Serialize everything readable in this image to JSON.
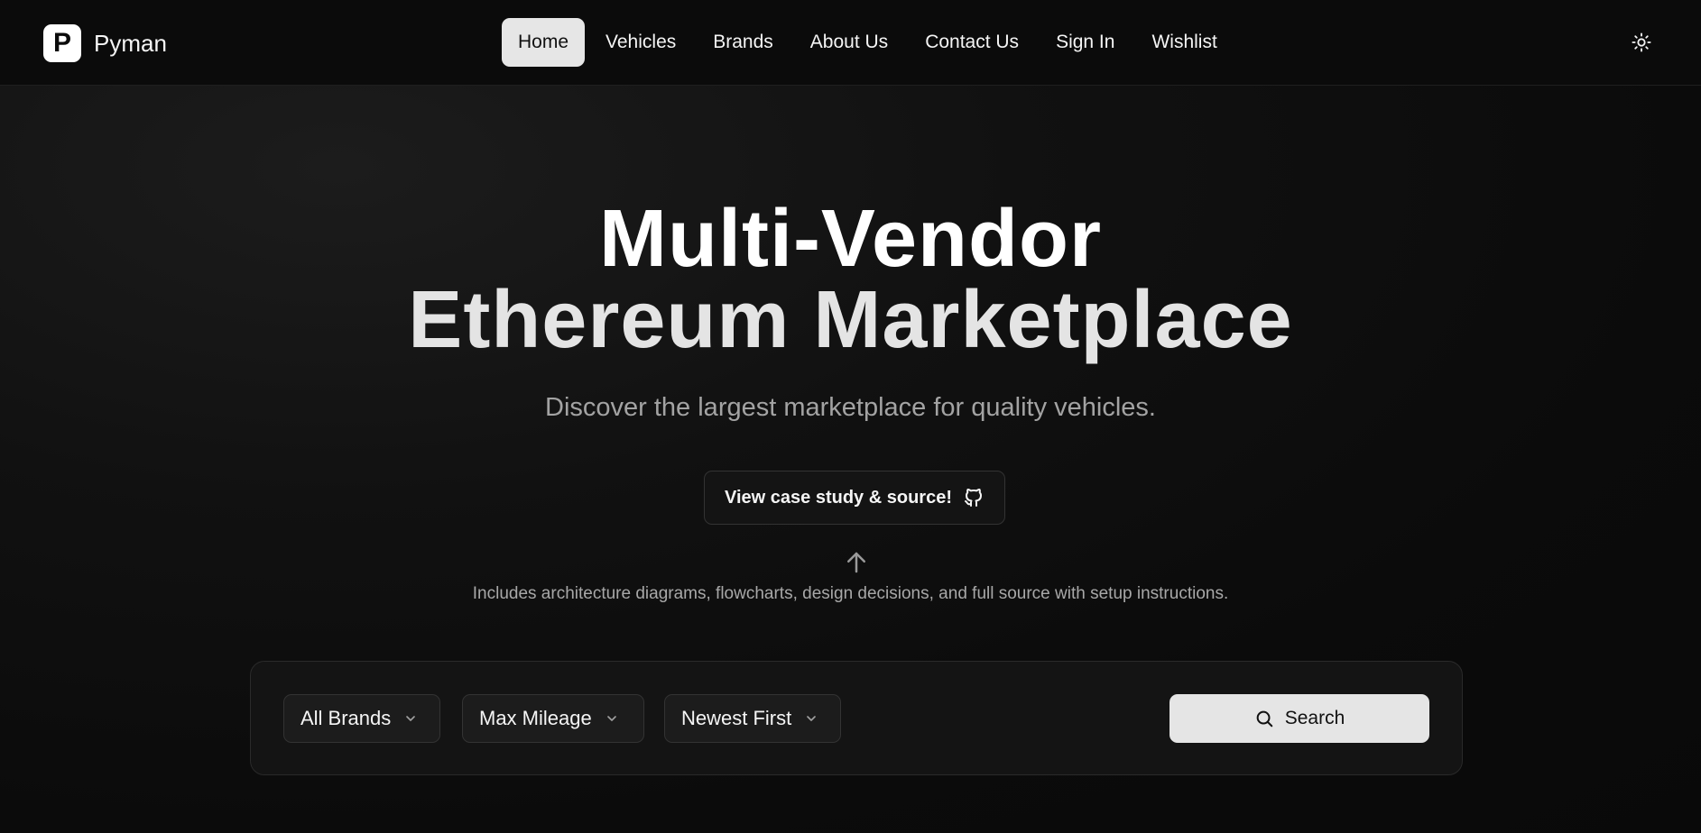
{
  "brand": {
    "logo_letter": "P",
    "name": "Pyman"
  },
  "nav": {
    "items": [
      {
        "label": "Home",
        "active": true
      },
      {
        "label": "Vehicles",
        "active": false
      },
      {
        "label": "Brands",
        "active": false
      },
      {
        "label": "About Us",
        "active": false
      },
      {
        "label": "Contact Us",
        "active": false
      },
      {
        "label": "Sign In",
        "active": false
      },
      {
        "label": "Wishlist",
        "active": false
      }
    ],
    "theme_toggle_icon": "sun-icon"
  },
  "hero": {
    "title_line1": "Multi-Vendor",
    "title_line2": "Ethereum Marketplace",
    "subtitle": "Discover the largest marketplace for quality vehicles.",
    "cta_label": "View case study & source!",
    "cta_icon": "github-icon",
    "arrow_icon": "arrow-up-icon",
    "note": "Includes architecture diagrams, flowcharts, design decisions, and full source with setup instructions."
  },
  "search": {
    "filters": [
      {
        "label": "All Brands"
      },
      {
        "label": "Max Mileage"
      },
      {
        "label": "Newest First"
      }
    ],
    "button_label": "Search",
    "button_icon": "search-icon"
  },
  "colors": {
    "background": "#0a0a0a",
    "active_nav_bg": "#e6e6e6",
    "search_button_bg": "#e5e5e5",
    "muted_text": "#a3a3a3"
  }
}
